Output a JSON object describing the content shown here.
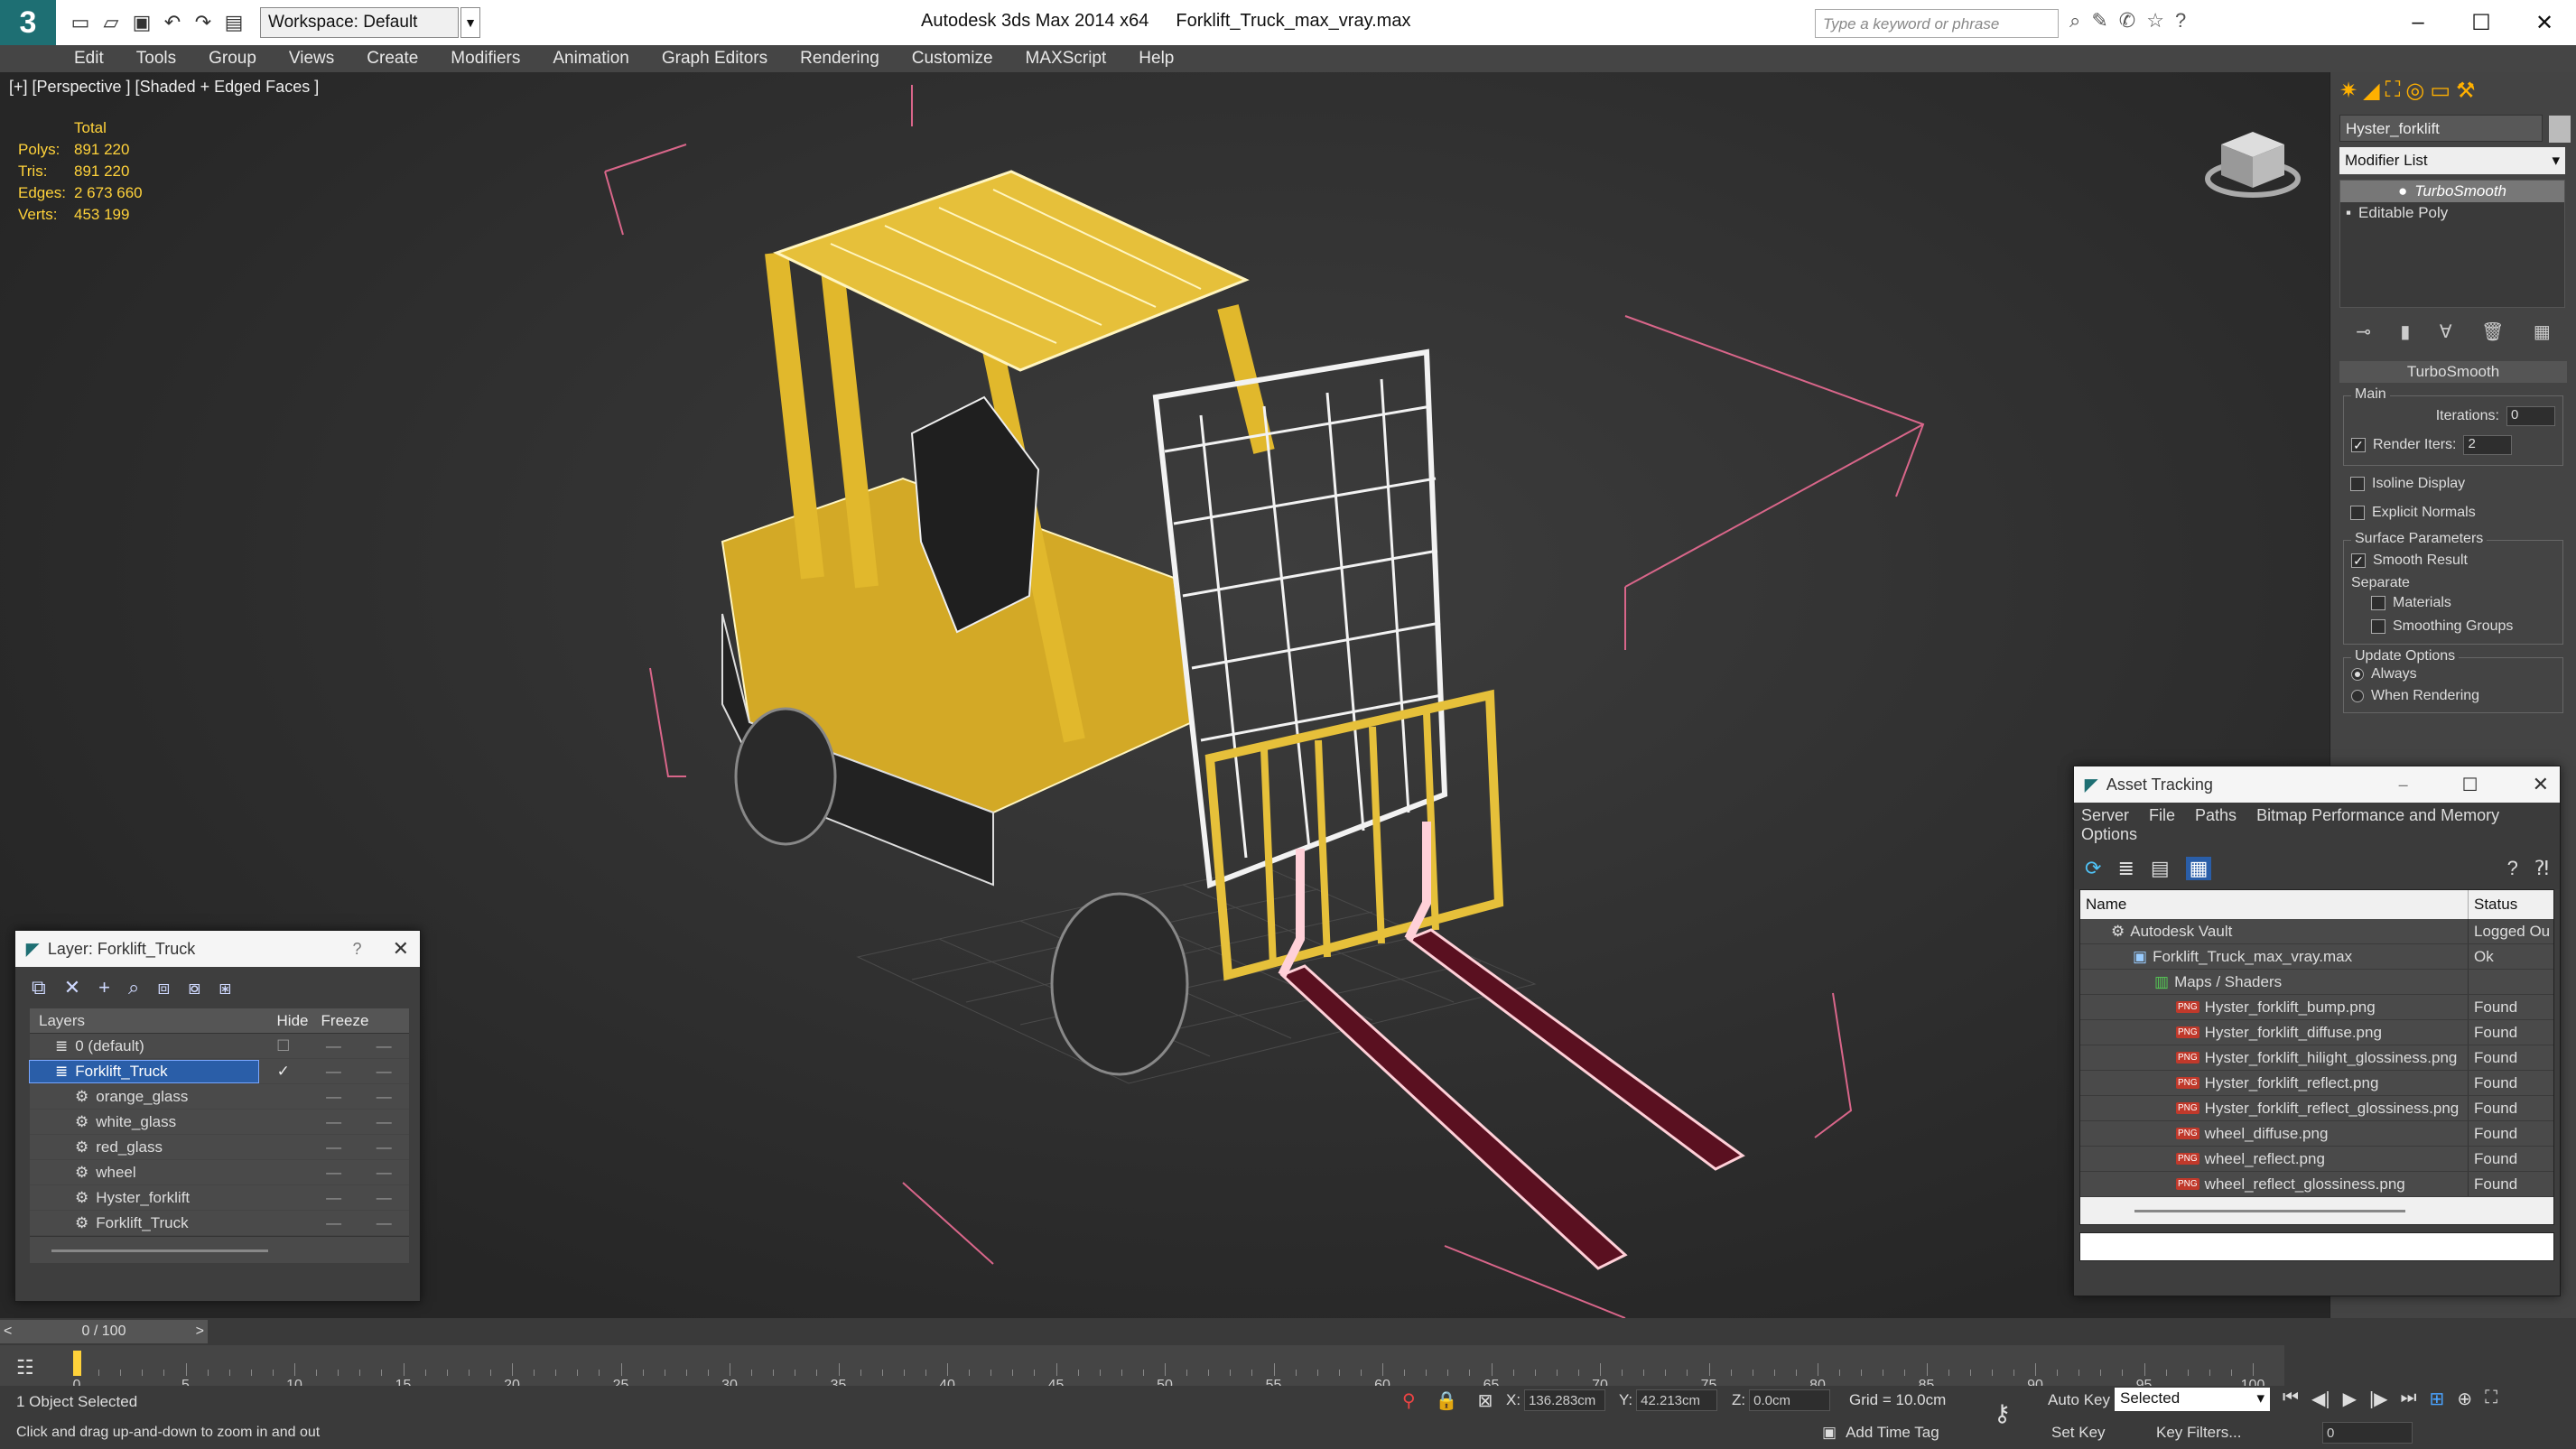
{
  "app": {
    "title": "Autodesk 3ds Max  2014 x64",
    "file": "Forklift_Truck_max_vray.max",
    "workspace": "Workspace: Default",
    "search_placeholder": "Type a keyword or phrase"
  },
  "menu": [
    "Edit",
    "Tools",
    "Group",
    "Views",
    "Create",
    "Modifiers",
    "Animation",
    "Graph Editors",
    "Rendering",
    "Customize",
    "MAXScript",
    "Help"
  ],
  "viewport": {
    "label": "[+] [Perspective ] [Shaded + Edged Faces ]",
    "stats_header": "Total",
    "stats": [
      {
        "k": "Polys:",
        "v": "891 220"
      },
      {
        "k": "Tris:",
        "v": "891 220"
      },
      {
        "k": "Edges:",
        "v": "2 673 660"
      },
      {
        "k": "Verts:",
        "v": "453 199"
      }
    ]
  },
  "right_panel": {
    "object_name": "Hyster_forklift",
    "modifier_list": "Modifier List",
    "stack": [
      "TurboSmooth",
      "Editable Poly"
    ],
    "rollout_title": "TurboSmooth",
    "main_label": "Main",
    "iterations_label": "Iterations:",
    "iterations_value": "0",
    "render_iters_label": "Render Iters:",
    "render_iters_value": "2",
    "isoline_label": "Isoline Display",
    "explicit_label": "Explicit Normals",
    "surface_label": "Surface Parameters",
    "smooth_label": "Smooth Result",
    "separate_label": "Separate",
    "materials_label": "Materials",
    "smoothing_groups_label": "Smoothing Groups",
    "update_label": "Update Options",
    "always_label": "Always",
    "when_rendering_label": "When Rendering"
  },
  "layer_panel": {
    "title": "Layer: Forklift_Truck",
    "help": "?",
    "col_layers": "Layers",
    "col_hide": "Hide",
    "col_freeze": "Freeze",
    "rows": [
      {
        "name": "0 (default)",
        "indent": 1,
        "sel": false
      },
      {
        "name": "Forklift_Truck",
        "indent": 1,
        "sel": true
      },
      {
        "name": "orange_glass",
        "indent": 2,
        "sel": false
      },
      {
        "name": "white_glass",
        "indent": 2,
        "sel": false
      },
      {
        "name": "red_glass",
        "indent": 2,
        "sel": false
      },
      {
        "name": "wheel",
        "indent": 2,
        "sel": false
      },
      {
        "name": "Hyster_forklift",
        "indent": 2,
        "sel": false
      },
      {
        "name": "Forklift_Truck",
        "indent": 2,
        "sel": false
      }
    ]
  },
  "asset_panel": {
    "title": "Asset Tracking",
    "menu": [
      "Server",
      "File",
      "Paths",
      "Bitmap Performance and Memory",
      "Options"
    ],
    "col_name": "Name",
    "col_status": "Status",
    "rows": [
      {
        "name": "Autodesk Vault",
        "status": "Logged Ou",
        "indent": 1,
        "kind": "vault"
      },
      {
        "name": "Forklift_Truck_max_vray.max",
        "status": "Ok",
        "indent": 2,
        "kind": "max"
      },
      {
        "name": "Maps / Shaders",
        "status": "",
        "indent": 3,
        "kind": "folder"
      },
      {
        "name": "Hyster_forklift_bump.png",
        "status": "Found",
        "indent": 4,
        "kind": "png"
      },
      {
        "name": "Hyster_forklift_diffuse.png",
        "status": "Found",
        "indent": 4,
        "kind": "png"
      },
      {
        "name": "Hyster_forklift_hilight_glossiness.png",
        "status": "Found",
        "indent": 4,
        "kind": "png"
      },
      {
        "name": "Hyster_forklift_reflect.png",
        "status": "Found",
        "indent": 4,
        "kind": "png"
      },
      {
        "name": "Hyster_forklift_reflect_glossiness.png",
        "status": "Found",
        "indent": 4,
        "kind": "png"
      },
      {
        "name": "wheel_diffuse.png",
        "status": "Found",
        "indent": 4,
        "kind": "png"
      },
      {
        "name": "wheel_reflect.png",
        "status": "Found",
        "indent": 4,
        "kind": "png"
      },
      {
        "name": "wheel_reflect_glossiness.png",
        "status": "Found",
        "indent": 4,
        "kind": "png"
      }
    ]
  },
  "timeline": {
    "frame": "0 / 100",
    "ticks": [
      0,
      5,
      10,
      15,
      20,
      25,
      30,
      35,
      40,
      45,
      50,
      55,
      60,
      65,
      70,
      75,
      80,
      85,
      90,
      95,
      100
    ]
  },
  "status": {
    "selected": "1 Object Selected",
    "hint": "Click and drag up-and-down to zoom in and out",
    "x_label": "X:",
    "x": "136.283cm",
    "y_label": "Y:",
    "y": "42.213cm",
    "z_label": "Z:",
    "z": "0.0cm",
    "grid": "Grid = 10.0cm",
    "add_time_tag": "Add Time Tag",
    "auto_key": "Auto Key",
    "set_key": "Set Key",
    "key_filters": "Key Filters...",
    "selected_dropdown": "Selected",
    "frame_field": "0"
  }
}
